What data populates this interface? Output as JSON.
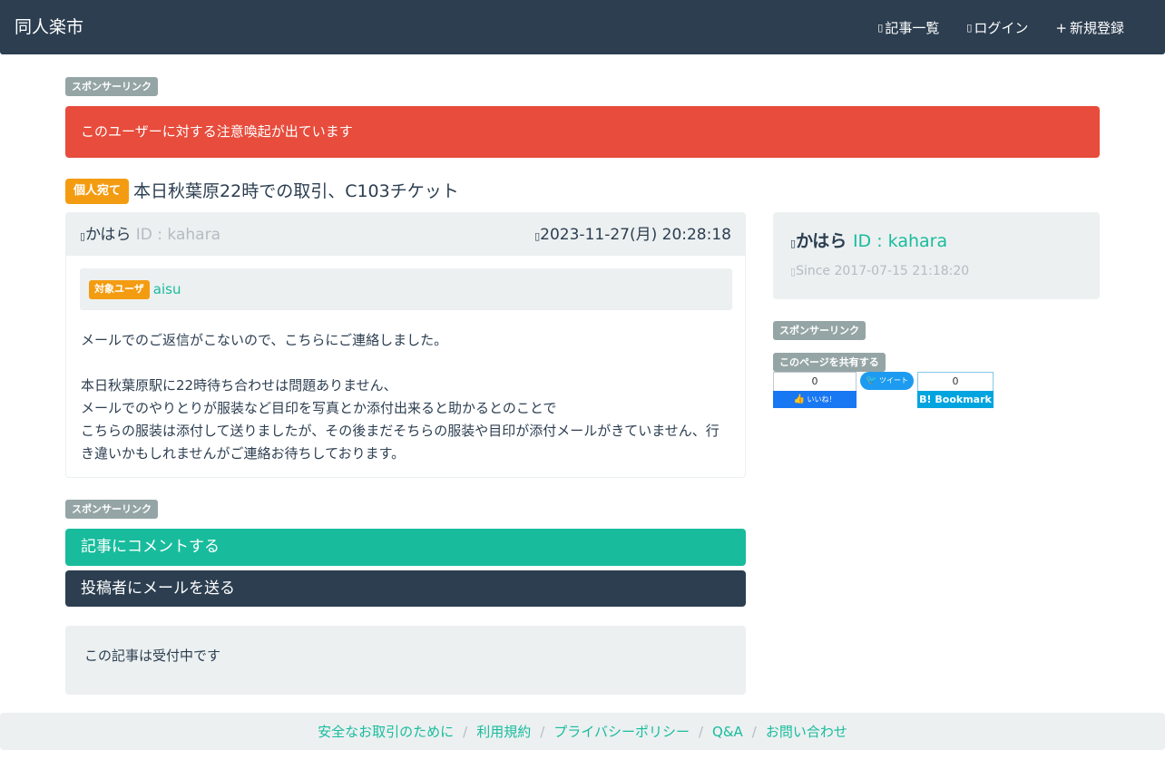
{
  "navbar": {
    "brand": "同人楽市",
    "links": [
      {
        "icon": "list-icon",
        "glyph": "▯",
        "label": "記事一覧"
      },
      {
        "icon": "login-icon",
        "glyph": "▯",
        "label": "ログイン"
      },
      {
        "icon": "plus-icon",
        "glyph": "+",
        "label": "新規登録"
      }
    ]
  },
  "sponsor_label": "スポンサーリンク",
  "alert_text": "このユーザーに対する注意喚起が出ています",
  "article": {
    "badge": "個人宛て",
    "title": "本日秋葉原22時での取引、C103チケット",
    "author_glyph": "▯",
    "author_name": "かはら",
    "author_id": "ID : kahara",
    "date_glyph": "▯",
    "datetime": "2023-11-27(月) 20:28:18",
    "target_badge": "対象ユーザ",
    "target_user": "aisu",
    "body": [
      "メールでのご返信がこないので、こちらにご連絡しました。",
      "",
      "本日秋葉原駅に22時待ち合わせは問題ありません、",
      "メールでのやりとりが服装など目印を写真とか添付出来ると助かるとのことで",
      "こちらの服装は添付して送りましたが、その後まだそちらの服装や目印が添付メールがきていません、行き違いかもしれませんがご連絡お待ちしております。"
    ]
  },
  "actions": {
    "comment": "記事にコメントする",
    "mail": "投稿者にメールを送る"
  },
  "status_text": "この記事は受付中です",
  "profile": {
    "glyph": "▯",
    "name": "かはら",
    "id": "ID : kahara",
    "since_glyph": "▯",
    "since": "Since 2017-07-15 21:18:20"
  },
  "share": {
    "label": "このページを共有する",
    "fb_count": "0",
    "fb_like": "いいね！",
    "tweet": "ツイート",
    "hb_count": "0",
    "hb_label": "B! Bookmark"
  },
  "footer": {
    "links": [
      "安全なお取引のために",
      "利用規約",
      "プライバシーポリシー",
      "Q&A",
      "お問い合わせ"
    ]
  },
  "colors": {
    "navbar": "#2c3e50",
    "accent": "#18bc9c",
    "danger": "#e74c3c",
    "warning": "#f39c12",
    "muted": "#95a5a6"
  }
}
